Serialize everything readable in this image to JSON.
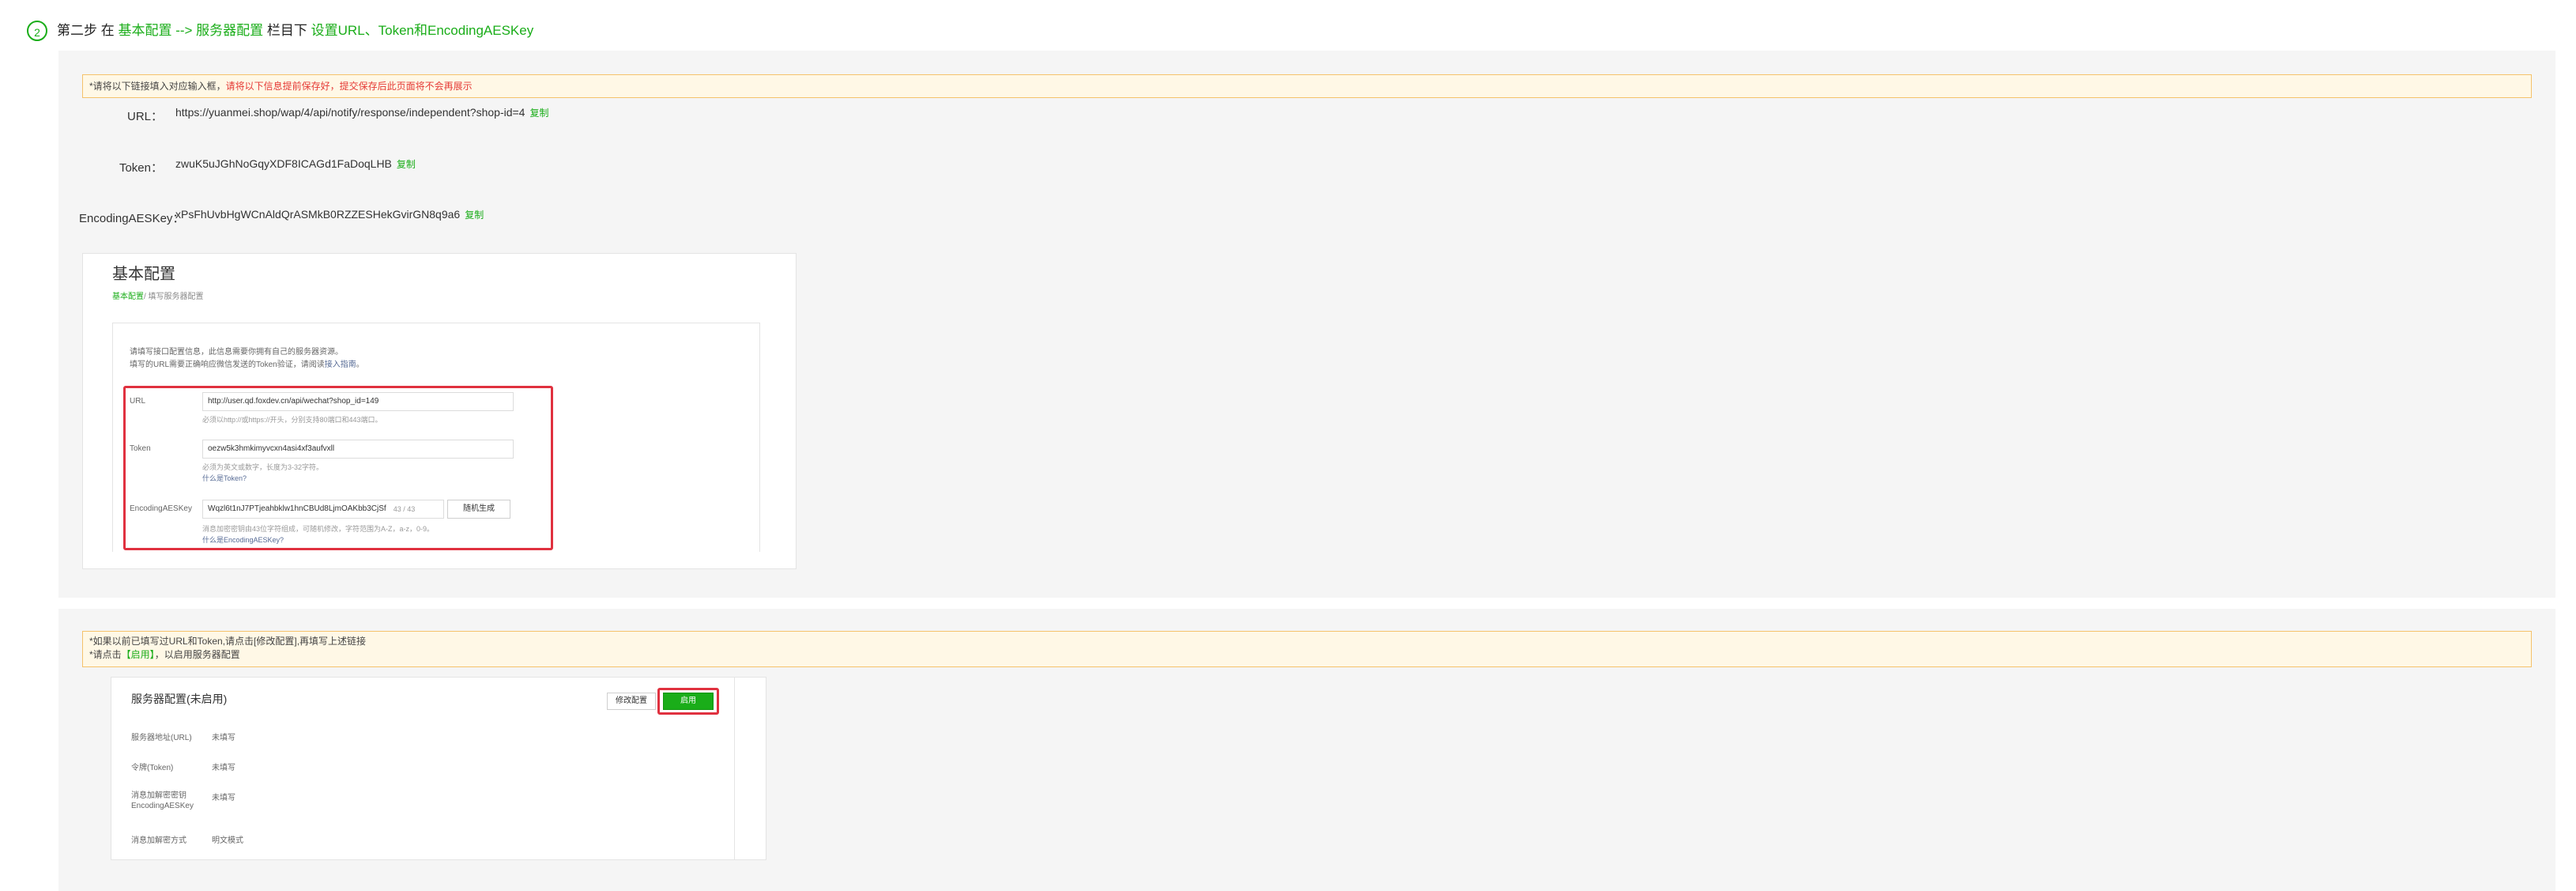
{
  "step": {
    "number": "2",
    "prefix": "第二步 在",
    "path": "基本配置 --> 服务器配置",
    "mid": "栏目下",
    "action": "设置URL、Token和EncodingAESKey"
  },
  "notice1": {
    "normal": "*请将以下链接填入对应输入框，",
    "red": "请将以下信息提前保存好，提交保存后此页面将不会再展示"
  },
  "fields": {
    "url": {
      "label": "URL：",
      "value": "https://yuanmei.shop/wap/4/api/notify/response/independent?shop-id=4",
      "copy": "复制"
    },
    "token": {
      "label": "Token：",
      "value": "zwuK5uJGhNoGqyXDF8ICAGd1FaDoqLHB",
      "copy": "复制"
    },
    "aes": {
      "label": "EncodingAESKey：",
      "value": "xPsFhUvbHgWCnAldQrASMkB0RZZESHekGvirGN8q9a6",
      "copy": "复制"
    }
  },
  "basic_shot": {
    "title": "基本配置",
    "breadcrumb_link": "基本配置",
    "breadcrumb_rest": "/ 填写服务器配置",
    "desc_line1": "请填写接口配置信息，此信息需要你拥有自己的服务器资源。",
    "desc_line2_prefix": "填写的URL需要正确响应微信发送的Token验证，请阅读",
    "desc_link": "接入指南",
    "desc_suffix": "。",
    "url_label": "URL",
    "url_value": "http://user.qd.foxdev.cn/api/wechat?shop_id=149",
    "url_hint": "必须以http://或https://开头，分别支持80端口和443端口。",
    "token_label": "Token",
    "token_value": "oezw5k3hmkimyvcxn4asi4xf3aufvxll",
    "token_hint": "必须为英文或数字，长度为3-32字符。",
    "token_link": "什么是Token?",
    "aes_label": "EncodingAESKey",
    "aes_value": "Wqzl6t1nJ7PTjeahbklw1hnCBUd8LjmOAKbb3CjSf",
    "aes_counter": "43 / 43",
    "aes_random_button": "随机生成",
    "aes_hint": "消息加密密钥由43位字符组成，可随机修改，字符范围为A-Z，a-z，0-9。",
    "aes_link": "什么是EncodingAESKey?"
  },
  "notice2": {
    "line1": "*如果以前已填写过URL和Token,请点击[修改配置],再填写上述链接",
    "line2_prefix": "*请点击",
    "line2_green": "【启用】",
    "line2_suffix": "，以启用服务器配置"
  },
  "server_shot": {
    "title": "服务器配置(未启用)",
    "modify_button": "修改配置",
    "enable_button": "启用",
    "rows": [
      {
        "label": "服务器地址(URL)",
        "value": "未填写"
      },
      {
        "label": "令牌(Token)",
        "value": "未填写"
      },
      {
        "label": "消息加解密密钥",
        "label2": "EncodingAESKey",
        "value": "未填写"
      },
      {
        "label": "消息加解密方式",
        "value": "明文模式"
      }
    ]
  },
  "colors": {
    "accent": "#1aad19",
    "warning_border": "#f5c26b",
    "warning_bg": "#fff8e6",
    "highlight_red": "#e0313f"
  }
}
